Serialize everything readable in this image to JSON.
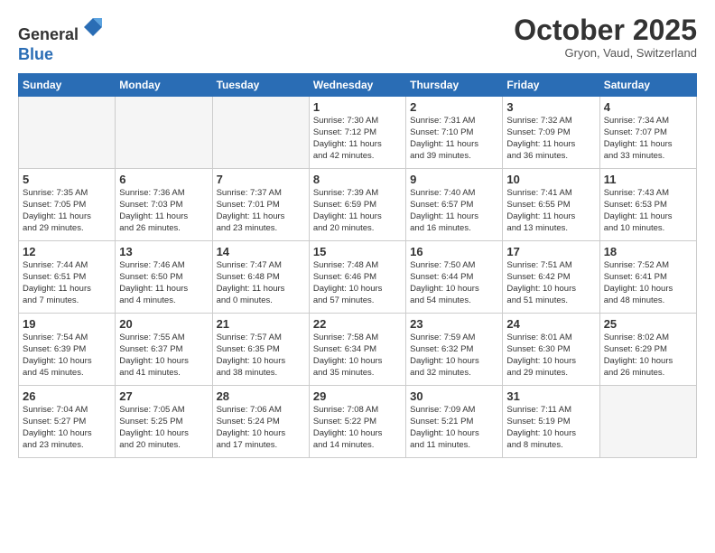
{
  "header": {
    "logo_line1": "General",
    "logo_line2": "Blue",
    "month": "October 2025",
    "location": "Gryon, Vaud, Switzerland"
  },
  "weekdays": [
    "Sunday",
    "Monday",
    "Tuesday",
    "Wednesday",
    "Thursday",
    "Friday",
    "Saturday"
  ],
  "weeks": [
    [
      {
        "day": "",
        "info": ""
      },
      {
        "day": "",
        "info": ""
      },
      {
        "day": "",
        "info": ""
      },
      {
        "day": "1",
        "info": "Sunrise: 7:30 AM\nSunset: 7:12 PM\nDaylight: 11 hours\nand 42 minutes."
      },
      {
        "day": "2",
        "info": "Sunrise: 7:31 AM\nSunset: 7:10 PM\nDaylight: 11 hours\nand 39 minutes."
      },
      {
        "day": "3",
        "info": "Sunrise: 7:32 AM\nSunset: 7:09 PM\nDaylight: 11 hours\nand 36 minutes."
      },
      {
        "day": "4",
        "info": "Sunrise: 7:34 AM\nSunset: 7:07 PM\nDaylight: 11 hours\nand 33 minutes."
      }
    ],
    [
      {
        "day": "5",
        "info": "Sunrise: 7:35 AM\nSunset: 7:05 PM\nDaylight: 11 hours\nand 29 minutes."
      },
      {
        "day": "6",
        "info": "Sunrise: 7:36 AM\nSunset: 7:03 PM\nDaylight: 11 hours\nand 26 minutes."
      },
      {
        "day": "7",
        "info": "Sunrise: 7:37 AM\nSunset: 7:01 PM\nDaylight: 11 hours\nand 23 minutes."
      },
      {
        "day": "8",
        "info": "Sunrise: 7:39 AM\nSunset: 6:59 PM\nDaylight: 11 hours\nand 20 minutes."
      },
      {
        "day": "9",
        "info": "Sunrise: 7:40 AM\nSunset: 6:57 PM\nDaylight: 11 hours\nand 16 minutes."
      },
      {
        "day": "10",
        "info": "Sunrise: 7:41 AM\nSunset: 6:55 PM\nDaylight: 11 hours\nand 13 minutes."
      },
      {
        "day": "11",
        "info": "Sunrise: 7:43 AM\nSunset: 6:53 PM\nDaylight: 11 hours\nand 10 minutes."
      }
    ],
    [
      {
        "day": "12",
        "info": "Sunrise: 7:44 AM\nSunset: 6:51 PM\nDaylight: 11 hours\nand 7 minutes."
      },
      {
        "day": "13",
        "info": "Sunrise: 7:46 AM\nSunset: 6:50 PM\nDaylight: 11 hours\nand 4 minutes."
      },
      {
        "day": "14",
        "info": "Sunrise: 7:47 AM\nSunset: 6:48 PM\nDaylight: 11 hours\nand 0 minutes."
      },
      {
        "day": "15",
        "info": "Sunrise: 7:48 AM\nSunset: 6:46 PM\nDaylight: 10 hours\nand 57 minutes."
      },
      {
        "day": "16",
        "info": "Sunrise: 7:50 AM\nSunset: 6:44 PM\nDaylight: 10 hours\nand 54 minutes."
      },
      {
        "day": "17",
        "info": "Sunrise: 7:51 AM\nSunset: 6:42 PM\nDaylight: 10 hours\nand 51 minutes."
      },
      {
        "day": "18",
        "info": "Sunrise: 7:52 AM\nSunset: 6:41 PM\nDaylight: 10 hours\nand 48 minutes."
      }
    ],
    [
      {
        "day": "19",
        "info": "Sunrise: 7:54 AM\nSunset: 6:39 PM\nDaylight: 10 hours\nand 45 minutes."
      },
      {
        "day": "20",
        "info": "Sunrise: 7:55 AM\nSunset: 6:37 PM\nDaylight: 10 hours\nand 41 minutes."
      },
      {
        "day": "21",
        "info": "Sunrise: 7:57 AM\nSunset: 6:35 PM\nDaylight: 10 hours\nand 38 minutes."
      },
      {
        "day": "22",
        "info": "Sunrise: 7:58 AM\nSunset: 6:34 PM\nDaylight: 10 hours\nand 35 minutes."
      },
      {
        "day": "23",
        "info": "Sunrise: 7:59 AM\nSunset: 6:32 PM\nDaylight: 10 hours\nand 32 minutes."
      },
      {
        "day": "24",
        "info": "Sunrise: 8:01 AM\nSunset: 6:30 PM\nDaylight: 10 hours\nand 29 minutes."
      },
      {
        "day": "25",
        "info": "Sunrise: 8:02 AM\nSunset: 6:29 PM\nDaylight: 10 hours\nand 26 minutes."
      }
    ],
    [
      {
        "day": "26",
        "info": "Sunrise: 7:04 AM\nSunset: 5:27 PM\nDaylight: 10 hours\nand 23 minutes."
      },
      {
        "day": "27",
        "info": "Sunrise: 7:05 AM\nSunset: 5:25 PM\nDaylight: 10 hours\nand 20 minutes."
      },
      {
        "day": "28",
        "info": "Sunrise: 7:06 AM\nSunset: 5:24 PM\nDaylight: 10 hours\nand 17 minutes."
      },
      {
        "day": "29",
        "info": "Sunrise: 7:08 AM\nSunset: 5:22 PM\nDaylight: 10 hours\nand 14 minutes."
      },
      {
        "day": "30",
        "info": "Sunrise: 7:09 AM\nSunset: 5:21 PM\nDaylight: 10 hours\nand 11 minutes."
      },
      {
        "day": "31",
        "info": "Sunrise: 7:11 AM\nSunset: 5:19 PM\nDaylight: 10 hours\nand 8 minutes."
      },
      {
        "day": "",
        "info": ""
      }
    ]
  ]
}
